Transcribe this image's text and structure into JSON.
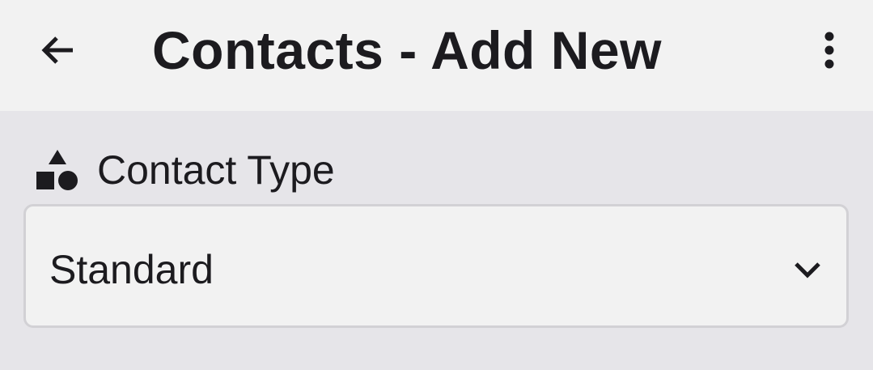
{
  "header": {
    "title": "Contacts - Add New",
    "back_icon": "arrow-left-icon",
    "menu_icon": "more-vertical-icon"
  },
  "contact_type": {
    "label": "Contact Type",
    "label_icon": "shapes-icon",
    "selected_value": "Standard",
    "dropdown_icon": "chevron-down-icon"
  },
  "colors": {
    "app_bar_background": "#f2f2f2",
    "page_background": "#e6e5e9",
    "field_background": "#f2f2f2",
    "field_border": "#d2d1d5",
    "text": "#1c1b1f"
  }
}
